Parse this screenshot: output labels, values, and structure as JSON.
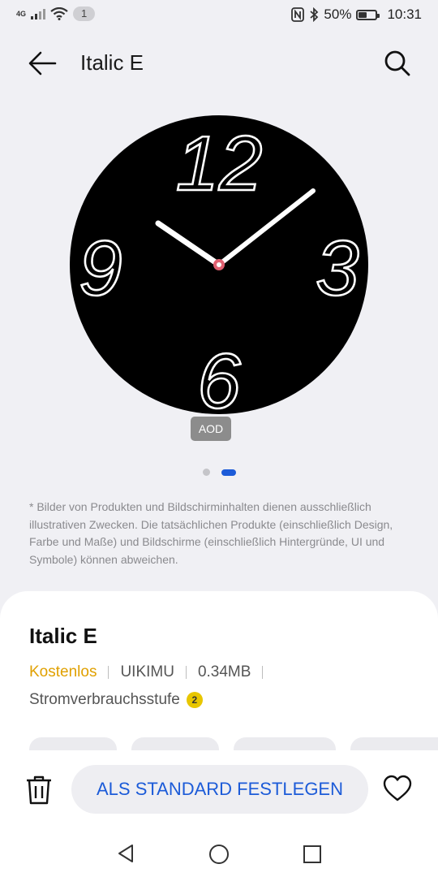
{
  "status_bar": {
    "network": "4G",
    "notification_count": "1",
    "battery": "50%",
    "battery_fraction": 0.5,
    "time": "10:31"
  },
  "app_bar": {
    "title": "Italic E",
    "back_icon": "arrow-left-icon",
    "search_icon": "search-icon"
  },
  "preview": {
    "watch_numerals": [
      "12",
      "3",
      "6",
      "9"
    ],
    "aod_label": "AOD",
    "page_count": 2,
    "active_page": 2
  },
  "disclaimer": "* Bilder von Produkten und Bildschirminhalten dienen ausschließlich illustrativen Zwecken. Die tatsächlichen Produkte (einschließlich Design, Farbe und Maße) und Bildschirme (einschließlich Hintergründe, UI und Symbole) können abweichen.",
  "details": {
    "name": "Italic E",
    "price": "Kostenlos",
    "author": "UIKIMU",
    "size": "0.34MB",
    "power_label": "Stromverbrauchsstufe",
    "power_level": "2"
  },
  "actions": {
    "delete_icon": "trash-icon",
    "primary_label": "ALS STANDARD FESTLEGEN",
    "favorite_icon": "heart-icon"
  },
  "colors": {
    "accent_blue": "#1c5bd8",
    "price_orange": "#e0a000",
    "power_badge_yellow": "#e8c600",
    "watch_face": "#000000",
    "hand_pivot": "#e06070"
  }
}
